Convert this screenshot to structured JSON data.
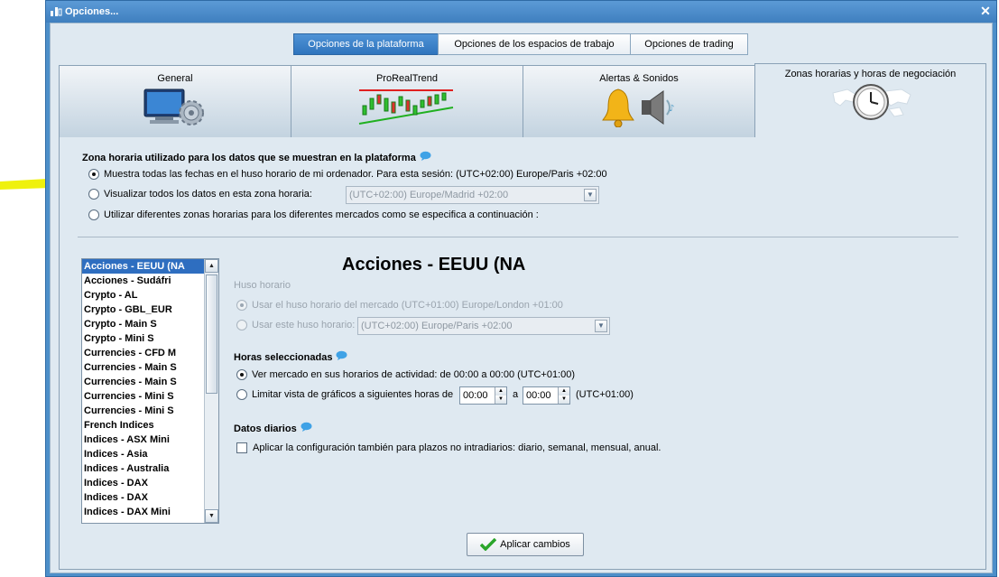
{
  "window": {
    "title": "Opciones...",
    "close_icon": "close-icon"
  },
  "top_tabs": [
    {
      "label": "Opciones de la plataforma",
      "active": true
    },
    {
      "label": "Opciones de los espacios de trabajo",
      "active": false
    },
    {
      "label": "Opciones de trading",
      "active": false
    }
  ],
  "category_tabs": [
    {
      "label": "General",
      "icon": "monitor-gear-icon"
    },
    {
      "label": "ProRealTrend",
      "icon": "trend-chart-icon"
    },
    {
      "label": "Alertas & Sonidos",
      "icon": "bell-speaker-icon"
    },
    {
      "label": "Zonas horarias y horas de negociación",
      "icon": "world-clock-icon",
      "active": true
    }
  ],
  "platform_timezone": {
    "title": "Zona horaria utilizado para los datos que se muestran en la plataforma",
    "option1": "Muestra todas las fechas en el huso horario de mi ordenador. Para esta sesión: (UTC+02:00) Europe/Paris +02:00",
    "option2": "Visualizar todos los datos en esta zona horaria:",
    "option2_combo": "(UTC+02:00) Europe/Madrid +02:00",
    "option3": "Utilizar diferentes zonas horarias para los diferentes mercados como se especifica a continuación :",
    "selected": 1
  },
  "markets_list": [
    "Acciones - EEUU (NA",
    "Acciones - Sudáfri",
    "Crypto - AL",
    "Crypto - GBL_EUR",
    "Crypto - Main S",
    "Crypto - Mini S",
    "Currencies - CFD M",
    "Currencies - Main S",
    "Currencies - Main S",
    "Currencies - Mini S",
    "Currencies - Mini S",
    "French Indices",
    "Indices - ASX Mini",
    "Indices - Asia",
    "Indices - Australia",
    "Indices - DAX",
    "Indices - DAX",
    "Indices - DAX Mini"
  ],
  "market_detail": {
    "title": "Acciones - EEUU (NA",
    "huso_horario_label": "Huso horario",
    "use_market_tz": "Usar el huso horario del mercado (UTC+01:00) Europe/London +01:00",
    "use_this_tz": "Usar este huso horario:",
    "use_this_tz_combo": "(UTC+02:00) Europe/Paris +02:00",
    "horas_label": "Horas seleccionadas",
    "ver_mercado": "Ver mercado en sus horarios de actividad: de 00:00 a 00:00  (UTC+01:00)",
    "limitar": "Limitar vista de gráficos a siguientes horas  de",
    "from_time": "00:00",
    "a_label": "a",
    "to_time": "00:00",
    "utc_suffix": "(UTC+01:00)",
    "datos_label": "Datos diarios",
    "aplicar_cfg": "Aplicar la configuración también para plazos no intradiarios: diario, semanal, mensual, anual."
  },
  "apply_button": "Aplicar cambios",
  "colors": {
    "accent": "#2e6ec0",
    "title_bar": "#4d8fc9",
    "panel_bg": "#dfe9f1",
    "highlight": "#f5f000"
  }
}
